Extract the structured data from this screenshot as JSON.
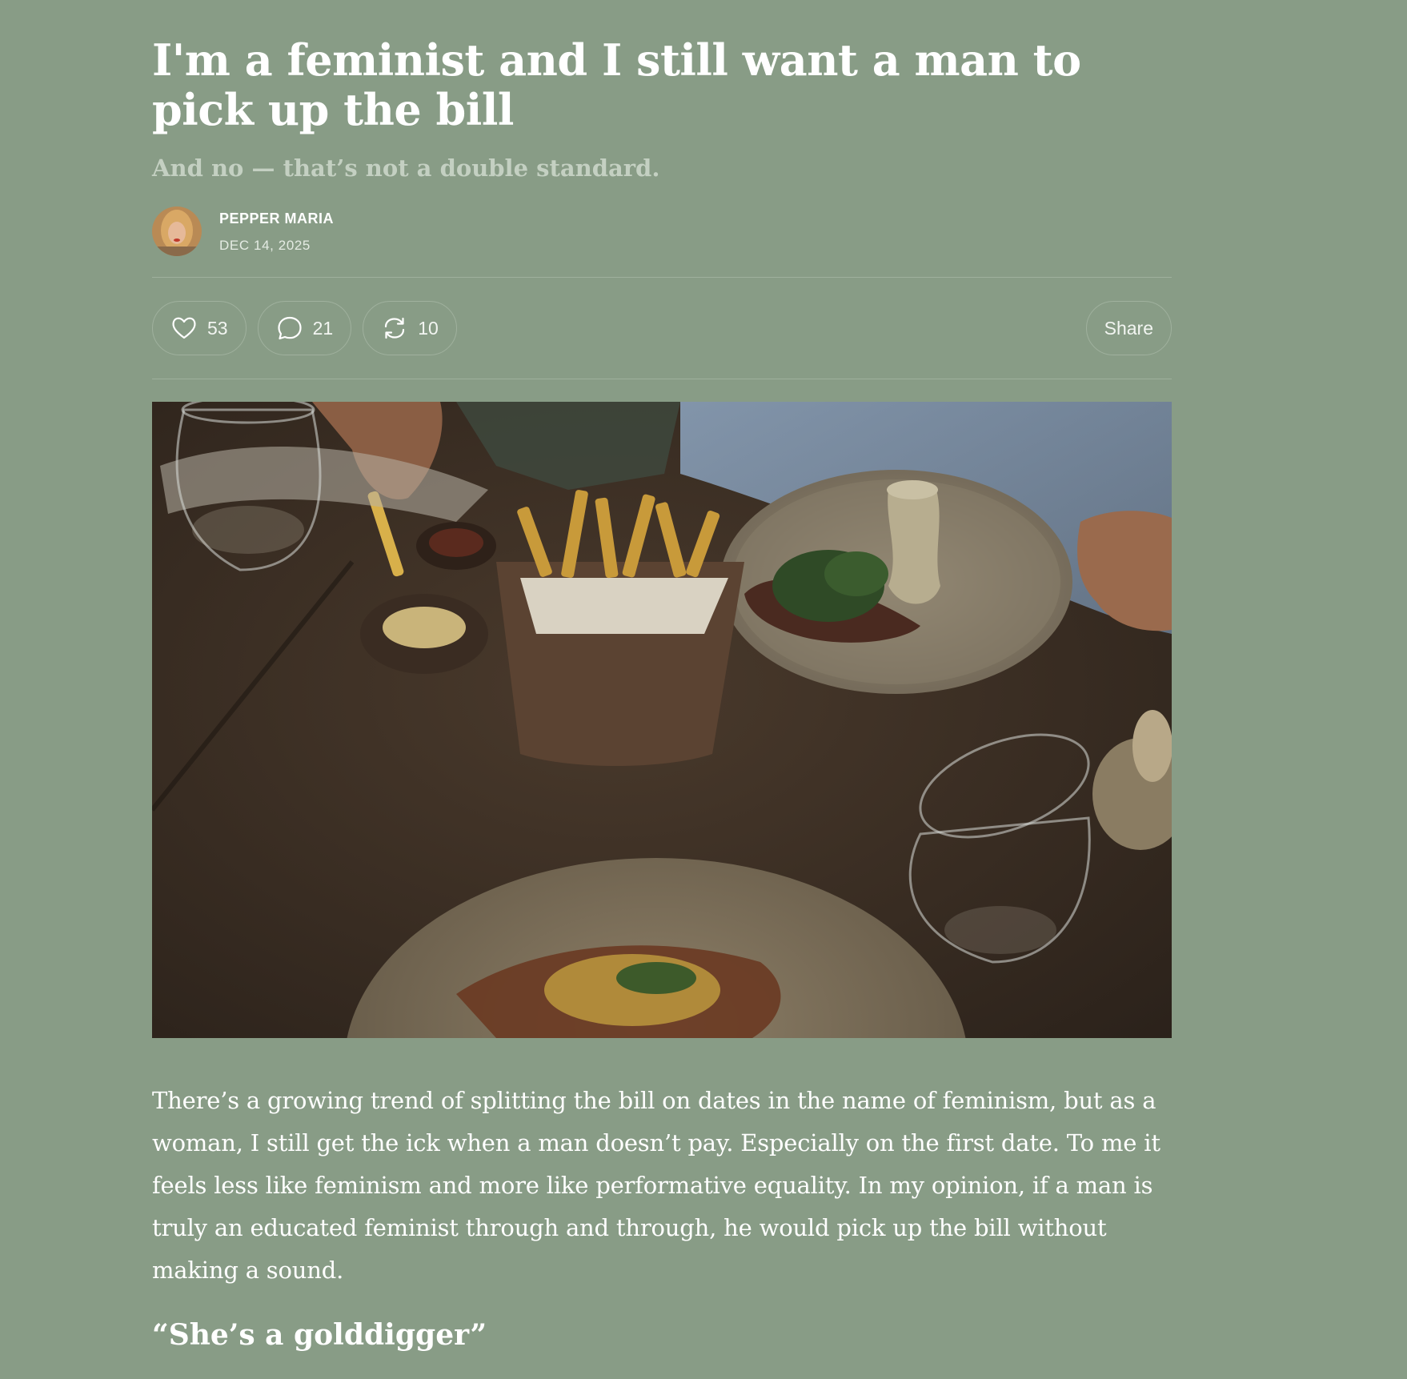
{
  "post": {
    "title": "I'm a feminist and I still want a man to pick up the bill",
    "subtitle": "And no — that’s not a double standard."
  },
  "author": {
    "name": "PEPPER MARIA",
    "date": "DEC 14, 2025"
  },
  "actions": {
    "likes": "53",
    "comments": "21",
    "restacks": "10",
    "share_label": "Share"
  },
  "icons": {
    "like": "heart-icon",
    "comment": "comment-bubble-icon",
    "restack": "restack-icon"
  },
  "image": {
    "description_hidden": ""
  },
  "body": {
    "paragraph_1": "There’s a growing trend of splitting the bill on dates in the name of feminism, but as a woman, I still get the ick when a man doesn’t pay. Especially on the first date. To me it feels less like feminism and more like performative equality. In my opinion, if a man is truly an educated feminist through and through, he would pick up the bill without making a sound.",
    "heading_1": "“She’s a golddigger”"
  },
  "colors": {
    "background": "#889c86",
    "subtitle": "#c4d0c2",
    "divider": "#9fb09d"
  }
}
